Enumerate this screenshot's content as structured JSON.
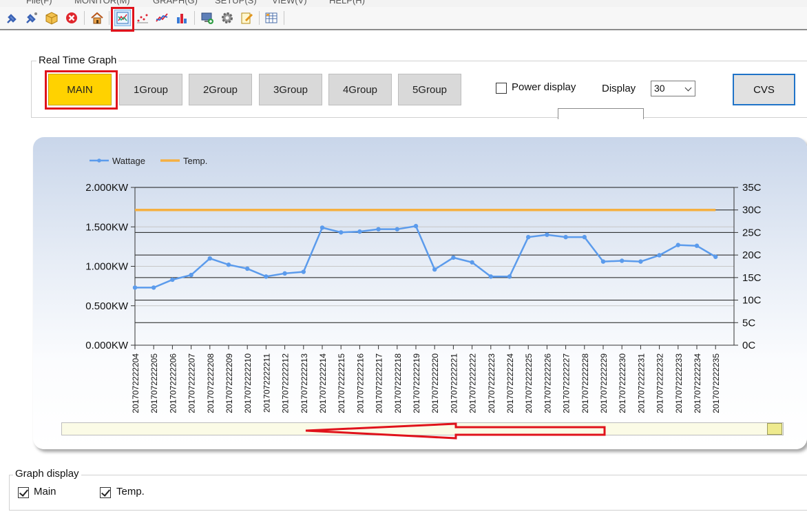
{
  "menu": {
    "items": [
      "File(F)",
      "MONITOR(M)",
      "GRAPH(G)",
      "SETUP(S)",
      "VIEW(V)",
      "HELP(H)"
    ]
  },
  "toolbar": {
    "icons": [
      "connect-icon",
      "disconnect-icon",
      "package-icon",
      "close-icon",
      "home-icon",
      "graph-icon",
      "scatter-icon",
      "line-chart-icon",
      "bar-chart-icon",
      "monitor-icon",
      "gear-icon",
      "edit-icon",
      "grid-icon"
    ]
  },
  "realtime": {
    "title": "Real Time Graph",
    "buttons": [
      "MAIN",
      "1Group",
      "2Group",
      "3Group",
      "4Group",
      "5Group"
    ],
    "selected": "MAIN",
    "power_display_label": "Power display",
    "power_display_checked": false,
    "display_label": "Display",
    "display_value": "30",
    "cvs_label": "CVS"
  },
  "chart_data": {
    "type": "line",
    "series": [
      {
        "name": "Wattage",
        "color": "#5b9bec",
        "values": [
          0.73,
          0.73,
          0.83,
          0.89,
          1.1,
          1.02,
          0.97,
          0.87,
          0.91,
          0.93,
          1.49,
          1.43,
          1.44,
          1.47,
          1.47,
          1.51,
          0.96,
          1.11,
          1.05,
          0.87,
          0.87,
          1.37,
          1.4,
          1.37,
          1.37,
          1.06,
          1.07,
          1.06,
          1.14,
          1.27,
          1.26,
          1.12
        ]
      },
      {
        "name": "Temp.",
        "color": "#f5b041",
        "values": [
          30,
          30,
          30,
          30,
          30,
          30,
          30,
          30,
          30,
          30,
          30,
          30,
          30,
          30,
          30,
          30,
          30,
          30,
          30,
          30,
          30,
          30,
          30,
          30,
          30,
          30,
          30,
          30,
          30,
          30,
          30,
          30
        ]
      }
    ],
    "categories": [
      "2017072222204",
      "2017072222205",
      "2017072222206",
      "2017072222207",
      "2017072222208",
      "2017072222209",
      "2017072222210",
      "2017072222211",
      "2017072222212",
      "2017072222213",
      "2017072222214",
      "2017072222215",
      "2017072222216",
      "2017072222217",
      "2017072222218",
      "2017072222219",
      "2017072222220",
      "2017072222221",
      "2017072222222",
      "2017072222223",
      "2017072222224",
      "2017072222225",
      "2017072222226",
      "2017072222227",
      "2017072222228",
      "2017072222229",
      "2017072222230",
      "2017072222231",
      "2017072222232",
      "2017072222233",
      "2017072222234",
      "2017072222235"
    ],
    "y_left": {
      "ticks": [
        "2.000KW",
        "1.500KW",
        "1.000KW",
        "0.500KW",
        "0.000KW"
      ],
      "ylim": [
        0,
        2
      ]
    },
    "y_right": {
      "ticks": [
        "35C",
        "30C",
        "25C",
        "20C",
        "15C",
        "10C",
        "5C",
        "0C"
      ],
      "ylim": [
        0,
        35
      ]
    },
    "legend_position": "top-left"
  },
  "graph_display": {
    "title": "Graph display",
    "main_label": "Main",
    "main_checked": true,
    "temp_label": "Temp.",
    "temp_checked": true
  }
}
